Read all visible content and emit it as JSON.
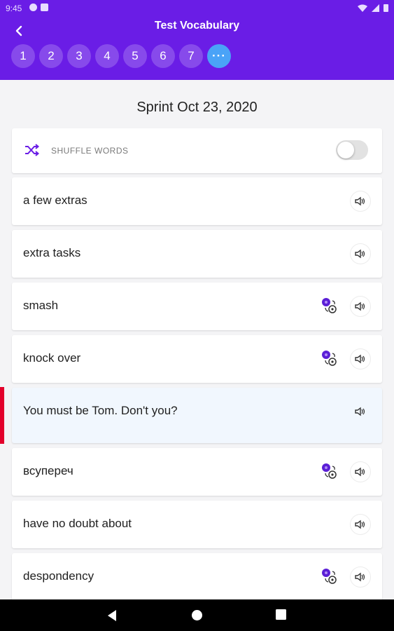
{
  "status_bar": {
    "time": "9:45"
  },
  "app_bar": {
    "title": "Test Vocabulary",
    "back_icon": "chevron-left-icon",
    "pages": [
      "1",
      "2",
      "3",
      "4",
      "5",
      "6",
      "7"
    ],
    "more_label": "···",
    "accent": "#6a1de6",
    "active_page_color": "#4aa3f7"
  },
  "heading": "Sprint Oct 23, 2020",
  "shuffle": {
    "label": "SHUFFLE WORDS",
    "enabled": false
  },
  "words": [
    {
      "text": "a few extras",
      "has_translate": false,
      "active": false
    },
    {
      "text": "extra tasks",
      "has_translate": false,
      "active": false
    },
    {
      "text": "smash",
      "has_translate": true,
      "active": false
    },
    {
      "text": "knock over",
      "has_translate": true,
      "active": false
    },
    {
      "text": "You must be Tom. Don't you?",
      "has_translate": false,
      "active": true
    },
    {
      "text": "всупереч",
      "has_translate": true,
      "active": false
    },
    {
      "text": "have no doubt about",
      "has_translate": false,
      "active": false
    },
    {
      "text": "despondency",
      "has_translate": true,
      "active": false
    }
  ],
  "colors": {
    "active_marker": "#e3002b",
    "active_row_bg": "#f1f7fe"
  }
}
